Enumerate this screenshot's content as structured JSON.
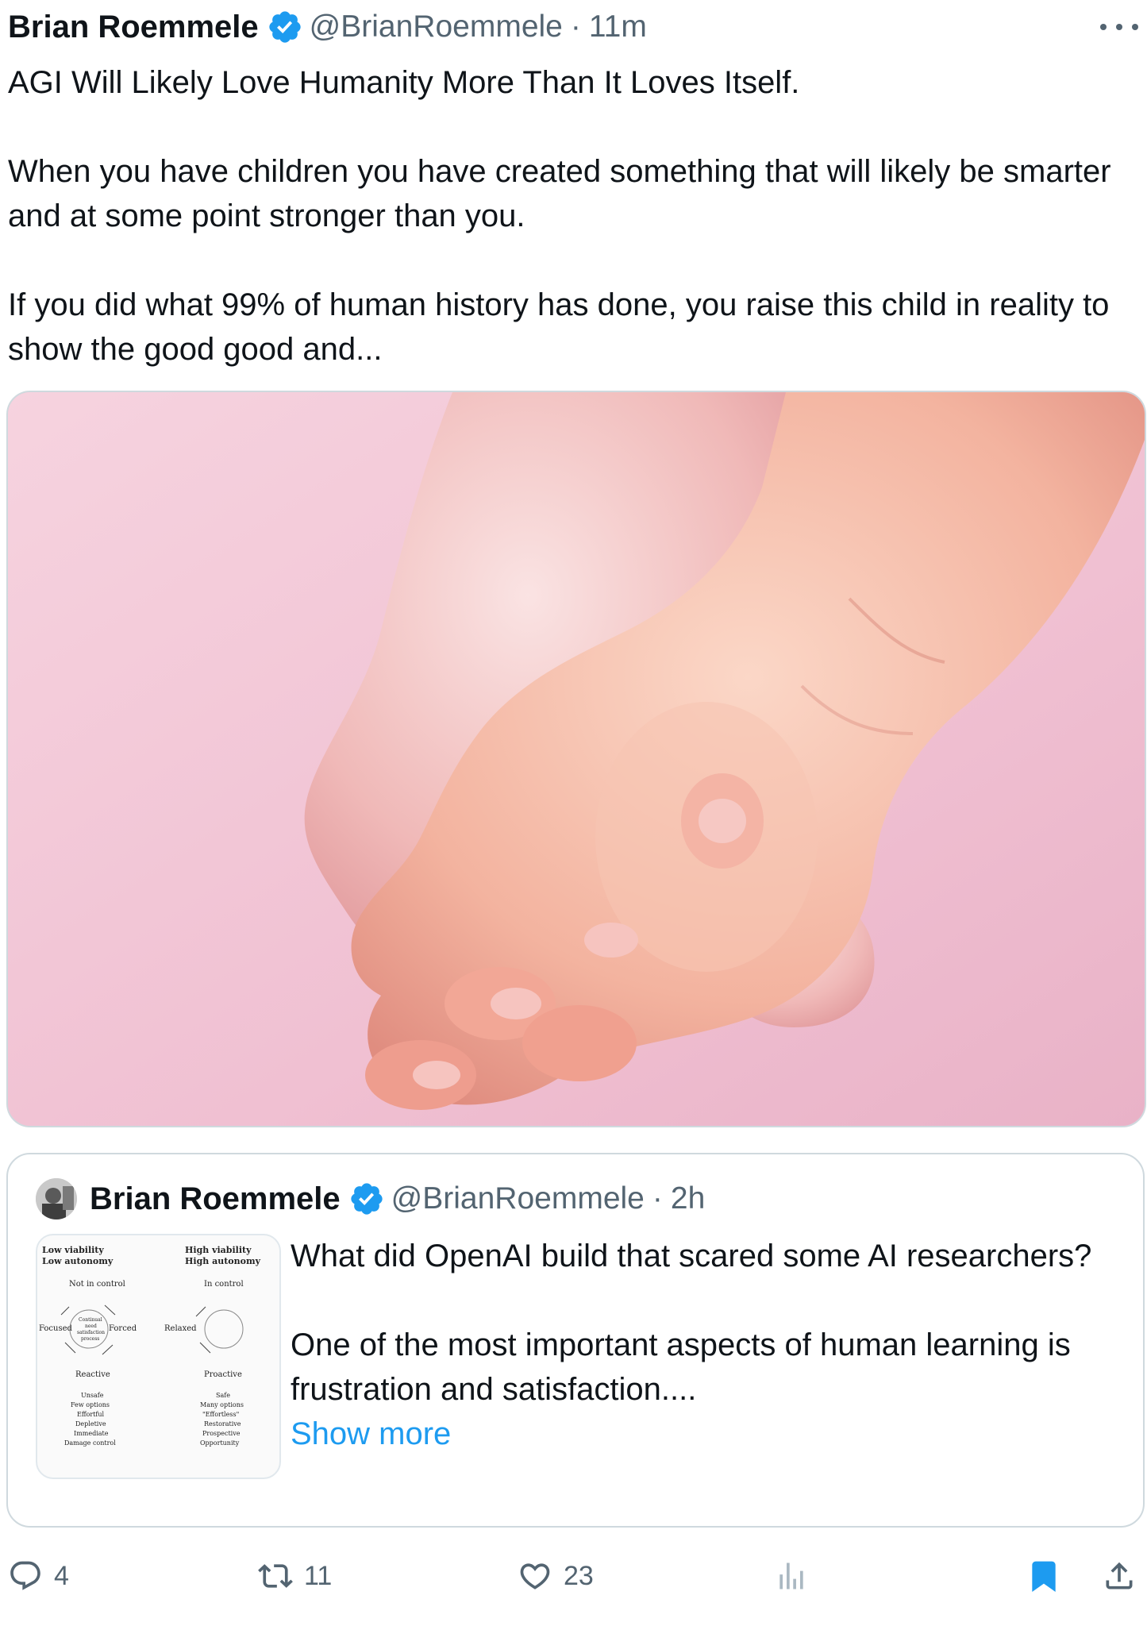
{
  "tweet": {
    "author_name": "Brian Roemmele",
    "handle": "@BrianRoemmele",
    "separator": "·",
    "time": "11m",
    "text": [
      "AGI Will Likely Love Humanity More Than It Loves Itself.",
      "When you have children you have created something that will likely be smarter and at some point stronger than you.",
      "If you did what 99% of human history has done, you raise this child in reality to show the good good and..."
    ],
    "image_icon": "adult-hand-holding-baby-hand-photo"
  },
  "quoted_tweet": {
    "author_name": "Brian Roemmele",
    "handle": "@BrianRoemmele",
    "separator": "·",
    "time": "2h",
    "text": [
      "What did OpenAI build that scared some AI researchers?",
      "One of the most important aspects of human learning is frustration and satisfaction...."
    ],
    "show_more": "Show more",
    "thumbnail": {
      "left": {
        "title_1": "Low viability",
        "title_2": "Low autonomy",
        "top": "Not in control",
        "side_left": "Focused",
        "side_right": "Forced",
        "center_1": "Continual",
        "center_2": "need",
        "center_3": "satisfaction",
        "center_4": "process",
        "bottom": "Reactive",
        "list": [
          "Unsafe",
          "Few options",
          "Effortful",
          "Depletive",
          "Immediate",
          "Damage control"
        ]
      },
      "right": {
        "title_1": "High viability",
        "title_2": "High autonomy",
        "top": "In control",
        "side_left": "Relaxed",
        "bottom": "Proactive",
        "list": [
          "Safe",
          "Many options",
          "\"Effortless\"",
          "Restorative",
          "Prospective",
          "Opportunity"
        ]
      }
    }
  },
  "actions": {
    "replies": "4",
    "reposts": "11",
    "likes": "23"
  },
  "colors": {
    "verified": "#1d9bf0",
    "link": "#1d9bf0",
    "secondary": "#536471",
    "bookmark_active": "#1d9bf0"
  }
}
